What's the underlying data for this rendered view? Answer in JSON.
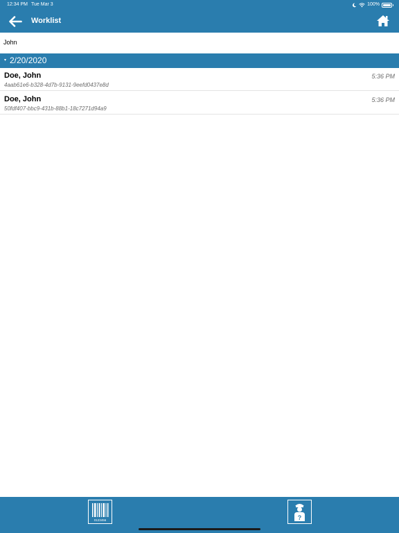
{
  "status_bar": {
    "time": "12:34 PM",
    "date": "Tue Mar 3",
    "battery": "100%"
  },
  "header": {
    "title": "Worklist",
    "back_icon": "arrow-left-icon",
    "home_icon": "home-icon"
  },
  "search": {
    "value": "John"
  },
  "group": {
    "date": "2/20/2020",
    "caret": "▾"
  },
  "items": [
    {
      "name": "Doe, John",
      "id": "4aab61e6-b328-4d7b-9131-9eefd0437e8d",
      "time": "5:36 PM"
    },
    {
      "name": "Doe, John",
      "id": "50fdf407-bbc9-431b-88b1-18c7271d94a9",
      "time": "5:36 PM"
    }
  ],
  "toolbar": {
    "barcode_icon": "barcode-scan-icon",
    "barcode_text": "0123456",
    "help_icon": "patient-help-icon"
  },
  "colors": {
    "accent": "#2a7dae",
    "row_border": "#e3e3e3",
    "secondary_text": "#6b6b6b"
  }
}
